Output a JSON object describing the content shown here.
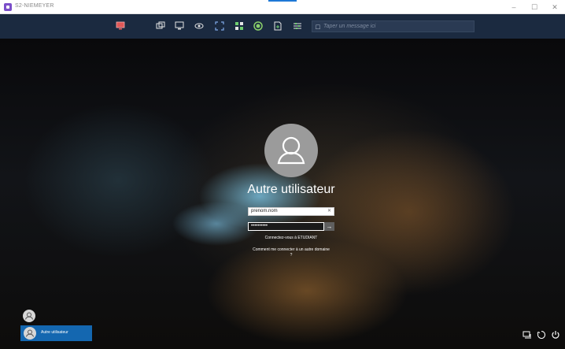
{
  "window": {
    "title": "S2-NIEMEYER",
    "controls": [
      "–",
      "☐",
      "✕"
    ]
  },
  "toolbar": {
    "icons": [
      "monitor-icon",
      "screens-icon",
      "display-icon",
      "view-icon",
      "fullscreen-icon",
      "grid-icon",
      "record-icon",
      "file-transfer-icon",
      "settings-sliders-icon"
    ],
    "message_placeholder": "Taper un message ici"
  },
  "login": {
    "username": "Autre utilisateur",
    "username_field_value": "prenom.nom",
    "password_field_value": "••••••••••",
    "sign_in_to": "Connectez-vous à ETUDIANT",
    "other_domain_link": "Comment me connecter à un autre domaine ?"
  },
  "user_switcher": {
    "selected_user": "Autre utilisateur"
  },
  "colors": {
    "toolbar": "#1b2a40",
    "tile_selected": "#1467b0",
    "accent": "#1e78d6"
  }
}
